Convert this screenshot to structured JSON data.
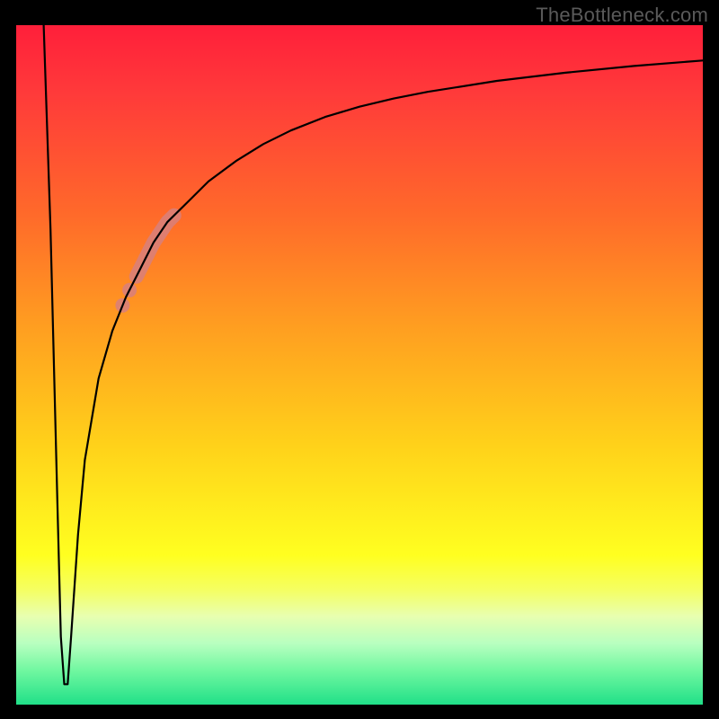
{
  "watermark": "TheBottleneck.com",
  "chart_data": {
    "type": "line",
    "title": "",
    "xlabel": "",
    "ylabel": "",
    "xlim": [
      0,
      100
    ],
    "ylim": [
      0,
      100
    ],
    "grid": false,
    "legend": false,
    "series": [
      {
        "name": "bottleneck-curve",
        "x": [
          4,
          5,
          6,
          6.5,
          7,
          7.5,
          8,
          9,
          10,
          12,
          14,
          16,
          18,
          20,
          22,
          25,
          28,
          32,
          36,
          40,
          45,
          50,
          55,
          60,
          70,
          80,
          90,
          100
        ],
        "y": [
          100,
          70,
          30,
          10,
          3,
          3,
          10,
          25,
          36,
          48,
          55,
          60,
          64,
          68,
          71,
          74,
          77,
          80,
          82.5,
          84.5,
          86.5,
          88,
          89.2,
          90.2,
          91.8,
          93,
          94,
          94.8
        ],
        "stroke": "#000000",
        "stroke_width": 2
      }
    ],
    "markers": [
      {
        "name": "highlight-bar",
        "x_start": 17.5,
        "x_end": 23,
        "on_series": 0,
        "color": "#d97f7a",
        "width": 16
      },
      {
        "name": "highlight-dot-1",
        "x": 16.5,
        "on_series": 0,
        "color": "#d97f7a",
        "r": 8
      },
      {
        "name": "highlight-dot-2",
        "x": 15.5,
        "on_series": 0,
        "color": "#d97f7a",
        "r": 8
      }
    ],
    "background_gradient": {
      "direction": "vertical",
      "stops": [
        {
          "pos": 0.0,
          "color": "#ff1f3a"
        },
        {
          "pos": 0.45,
          "color": "#ffa020"
        },
        {
          "pos": 0.78,
          "color": "#ffff20"
        },
        {
          "pos": 1.0,
          "color": "#20e088"
        }
      ]
    }
  }
}
